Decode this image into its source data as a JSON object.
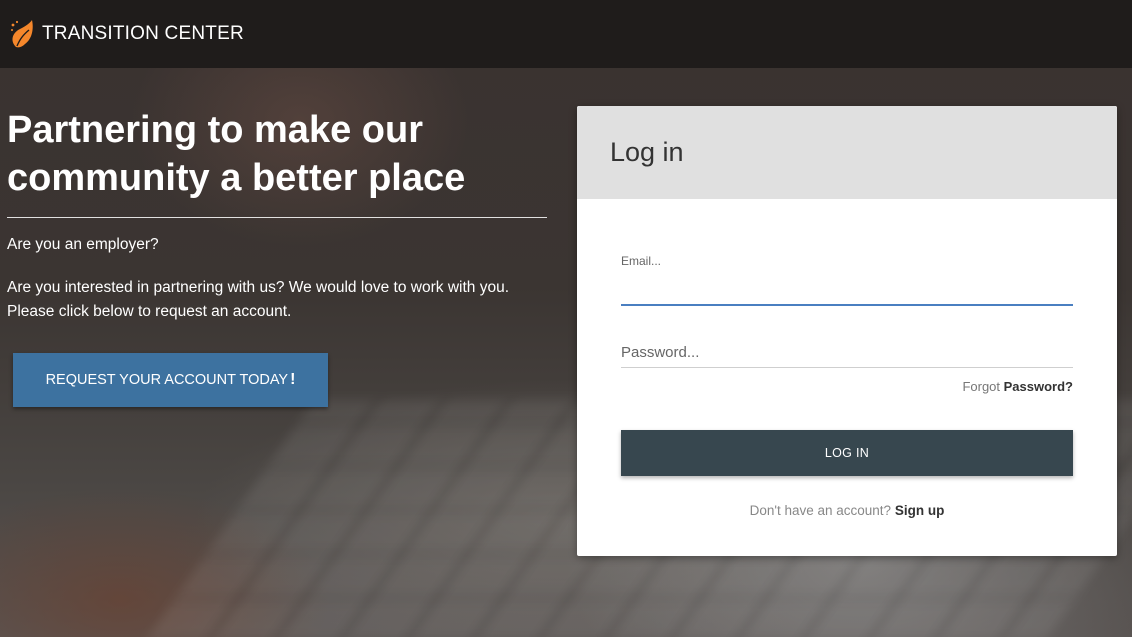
{
  "header": {
    "brand_part1": "TRANSITION",
    "brand_part2": "CENTER",
    "logo_icon": "flame-leaf-icon",
    "accent_color": "#f5872b"
  },
  "hero": {
    "title": "Partnering to make our community a better place",
    "question": "Are you an employer?",
    "description": "Are you interested in partnering with us? We would love to work with you. Please click below to request an account.",
    "request_button_label": "REQUEST YOUR ACCOUNT TODAY",
    "request_button_suffix": "!",
    "request_button_color": "#3d72a0"
  },
  "login": {
    "title": "Log in",
    "email_label": "Email...",
    "email_value": "",
    "password_placeholder": "Password...",
    "forgot_prefix": "Forgot",
    "forgot_link": "Password?",
    "login_button_label": "LOG IN",
    "login_button_color": "#37474f",
    "signup_prefix": "Don't have an account?",
    "signup_link": "Sign up"
  }
}
